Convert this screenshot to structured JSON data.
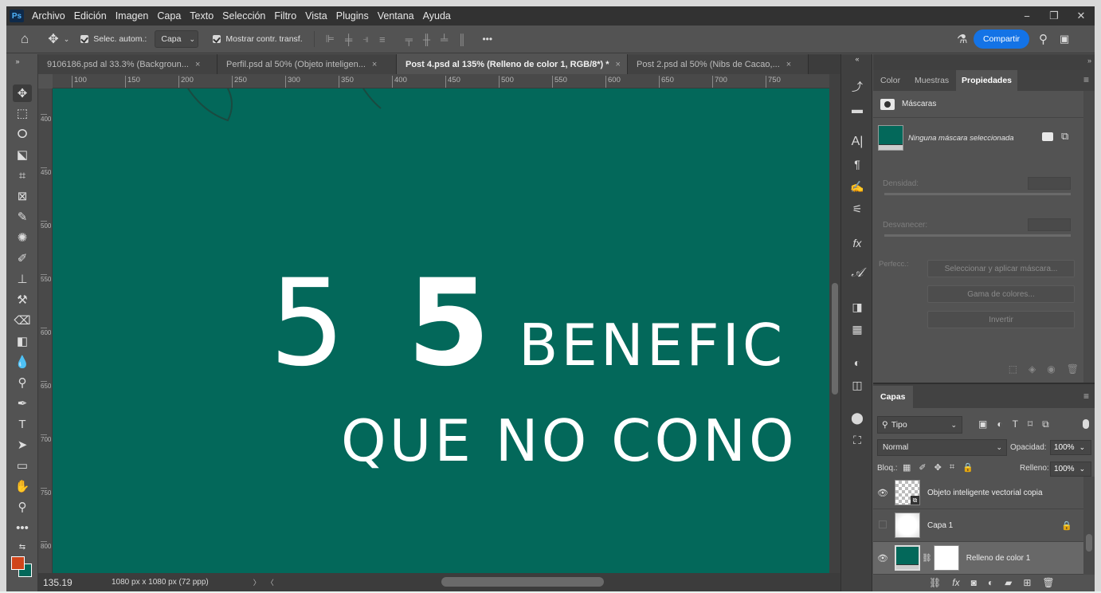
{
  "app": {
    "logo": "Ps"
  },
  "menu": [
    "Archivo",
    "Edición",
    "Imagen",
    "Capa",
    "Texto",
    "Selección",
    "Filtro",
    "Vista",
    "Plugins",
    "Ventana",
    "Ayuda"
  ],
  "window_controls": {
    "minimize": "−",
    "restore": "❐",
    "close": "✕"
  },
  "options_bar": {
    "auto_select_label": "Selec. autom.:",
    "auto_select_target": "Capa",
    "transform_label": "Mostrar contr. transf.",
    "more": "•••",
    "share_label": "Compartir"
  },
  "tabs": [
    {
      "label": "9106186.psd al 33.3% (Backgroun...",
      "close": "×"
    },
    {
      "label": "Perfil.psd al 50% (Objeto inteligen...",
      "close": "×"
    },
    {
      "label": "Post 4.psd al 135% (Relleno de color 1, RGB/8*) *",
      "close": "×"
    },
    {
      "label": "Post 2.psd al 50% (Nibs de Cacao,...",
      "close": "×"
    }
  ],
  "ruler": {
    "top": [
      "100",
      "150",
      "200",
      "250",
      "300",
      "350",
      "400",
      "450",
      "500",
      "550",
      "600",
      "650",
      "700",
      "750"
    ],
    "left": [
      "400",
      "450",
      "500",
      "550",
      "600",
      "650",
      "700",
      "750",
      "800"
    ]
  },
  "canvas": {
    "line1_num_a": "5",
    "line1_num_b": "5",
    "line1_word": "BENEFIC",
    "line2": "QUE NO CONO",
    "bg_color": "#03685a"
  },
  "status": {
    "zoom": "135.19",
    "doc_size": "1080 px x 1080 px (72 ppp)",
    "arrow": "〉",
    "arrow_left": "〈"
  },
  "properties": {
    "tabs": [
      "Color",
      "Muestras",
      "Propiedades"
    ],
    "section": "Máscaras",
    "mask_text": "Ninguna máscara seleccionada",
    "density_label": "Densidad:",
    "feather_label": "Desvanecer:",
    "refine_label": "Perfecc.:",
    "btn_select_mask": "Seleccionar y aplicar máscara...",
    "btn_color_range": "Gama de colores...",
    "btn_invert": "Invertir"
  },
  "layers_panel": {
    "title": "Capas",
    "filter": "Tipo",
    "blend_mode": "Normal",
    "opacity_label": "Opacidad:",
    "opacity_value": "100%",
    "lock_label": "Bloq.:",
    "fill_label": "Relleno:",
    "fill_value": "100%",
    "layers": [
      {
        "name": "Objeto inteligente vectorial copia",
        "visible": true
      },
      {
        "name": "Capa 1",
        "visible": false
      },
      {
        "name": "Relleno de color 1",
        "visible": true
      }
    ],
    "footer_icons": [
      "link-icon",
      "fx-icon",
      "mask-icon",
      "adjustment-icon",
      "folder-icon",
      "new-layer-icon",
      "trash-icon"
    ]
  },
  "icons": {
    "home": "⌂",
    "move": "✥",
    "search": "⚲",
    "flask": "⚗",
    "eye": "●",
    "lock": "🔒",
    "menu": "≡"
  },
  "colors": {
    "foreground": "#d0451b",
    "background": "#03685a",
    "accent": "#1473e6"
  }
}
